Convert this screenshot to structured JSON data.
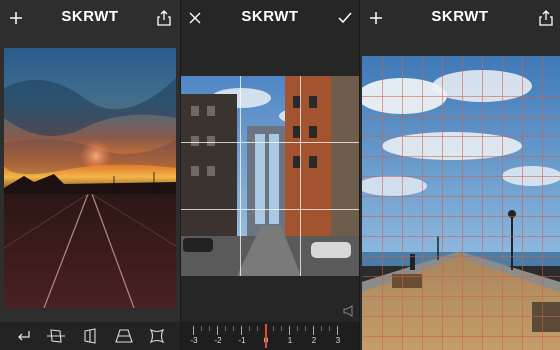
{
  "panels": [
    {
      "title": "SKRWT",
      "left_icon": "plus-icon",
      "right_icon": "share-icon"
    },
    {
      "title": "SKRWT",
      "left_icon": "close-icon",
      "right_icon": "checkmark-icon"
    },
    {
      "title": "SKRWT",
      "left_icon": "plus-icon",
      "right_icon": "share-icon"
    }
  ],
  "toolbar": {
    "tools": [
      "rotate-back-icon",
      "horizon-icon",
      "vertical-perspective-icon",
      "horizontal-perspective-icon",
      "lens-distortion-icon"
    ]
  },
  "ruler": {
    "labels": [
      "-3",
      "-2",
      "-1",
      "0",
      "1",
      "2",
      "3"
    ],
    "selected": "0"
  },
  "colors": {
    "accent": "#e0502a",
    "topbar": "#2e2e2e"
  }
}
